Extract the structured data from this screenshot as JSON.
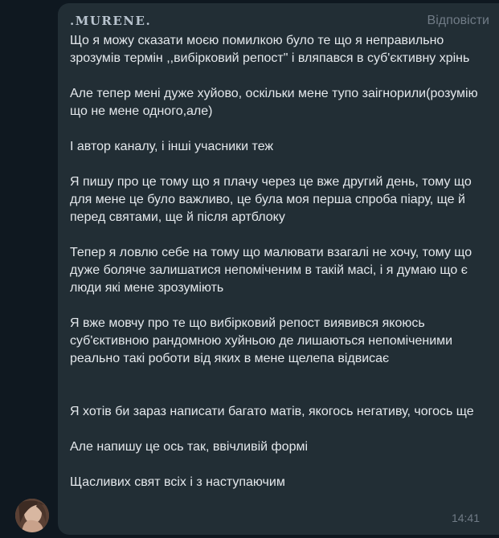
{
  "message": {
    "sender_name": ".MURENE.",
    "reply_label": "Відповісти",
    "timestamp": "14:41",
    "paragraphs": [
      "Що я можу сказати моєю помилкою було те що я неправильно зрозумів термін ,,вибірковий репост\" і вляпався в суб'єктивну хрінь",
      "Але тепер мені дуже хуйово, оскільки мене тупо заігнорили(розумію що не мене одного,але)",
      "І автор каналу, і інші учасники теж",
      "Я пишу про це тому що я плачу через це вже другий день, тому що для мене це було важливо, це була моя перша спроба піару, ще й перед святами, ще й після артблоку",
      "Тепер я ловлю себе на тому що малювати взагалі не хочу, тому що дуже боляче залишатися непоміченим в такій масі, і я думаю що є люди які мене зрозуміють",
      "Я вже мовчу про те що вибірковий репост виявився якоюсь суб'єктивною рандомною хуйньою де лишаються непоміченими реально такі роботи від яких в мене щелепа відвисає",
      "Я хотів би зараз написати багато матів, якогось негативу, чогось ще",
      "Але напишу це ось так, ввічливій формі",
      "Щасливих свят всіх і з наступаючим"
    ]
  }
}
